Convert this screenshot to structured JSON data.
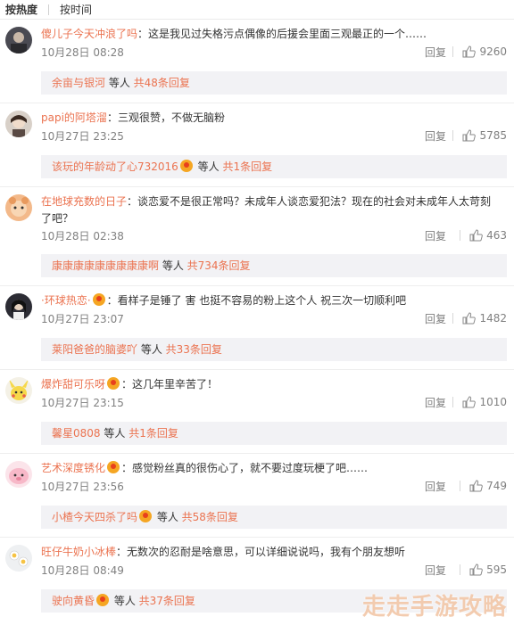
{
  "sort": {
    "hot": "按热度",
    "time": "按时间"
  },
  "comments": [
    {
      "user": "傻儿子今天冲浪了吗",
      "text": "：这是我见过失格污点偶像的后援会里面三观最正的一个……",
      "time": "10月28日 08:28",
      "reply": "回复",
      "likes": "9260",
      "sub_user": "余亩与银河",
      "sub_mid": " 等人 ",
      "sub_count": "共48条回复"
    },
    {
      "user": "papi的阿塔溜",
      "text": "：三观很赞，不做无脑粉",
      "time": "10月27日 23:25",
      "reply": "回复",
      "likes": "5785",
      "sub_user": "该玩的年龄动了心732016",
      "sub_mid": " 等人 ",
      "sub_count": "共1条回复"
    },
    {
      "user": "在地球充数的日子",
      "text": "：谈恋爱不是很正常吗？未成年人谈恋爱犯法？现在的社会对未成年人太苛刻了吧？",
      "time": "10月28日 02:38",
      "reply": "回复",
      "likes": "463",
      "sub_user": "康康康康康康康康康啊",
      "sub_mid": " 等人 ",
      "sub_count": "共734条回复"
    },
    {
      "user": "·环球热恋·",
      "text": "：看样子是锤了 害 也挺不容易的粉上这个人 祝三次一切顺利吧",
      "time": "10月27日 23:07",
      "reply": "回复",
      "likes": "1482",
      "sub_user": "莱阳爸爸的脑婆吖",
      "sub_mid": " 等人 ",
      "sub_count": "共33条回复"
    },
    {
      "user": "爆炸甜可乐呀",
      "text": "：这几年里辛苦了！",
      "time": "10月27日 23:15",
      "reply": "回复",
      "likes": "1010",
      "sub_user": "馨星0808",
      "sub_mid": " 等人 ",
      "sub_count": "共1条回复"
    },
    {
      "user": "艺术深度锈化",
      "text": "：感觉粉丝真的很伤心了，就不要过度玩梗了吧……",
      "time": "10月27日 23:56",
      "reply": "回复",
      "likes": "749",
      "sub_user": "小楂今天四杀了吗",
      "sub_mid": " 等人 ",
      "sub_count": "共58条回复"
    },
    {
      "user": "旺仔牛奶小冰棒",
      "text": "：无数次的忍耐是啥意思，可以详细说说吗，我有个朋友想听",
      "time": "10月28日 08:49",
      "reply": "回复",
      "likes": "595",
      "sub_user": "驶向黄昏",
      "sub_mid": " 等人 ",
      "sub_count": "共37条回复"
    }
  ],
  "watermark": "走走手游攻略",
  "colors": {
    "username": "#eb7350",
    "meta": "#808080",
    "subreply_bg": "#f2f2f5"
  }
}
